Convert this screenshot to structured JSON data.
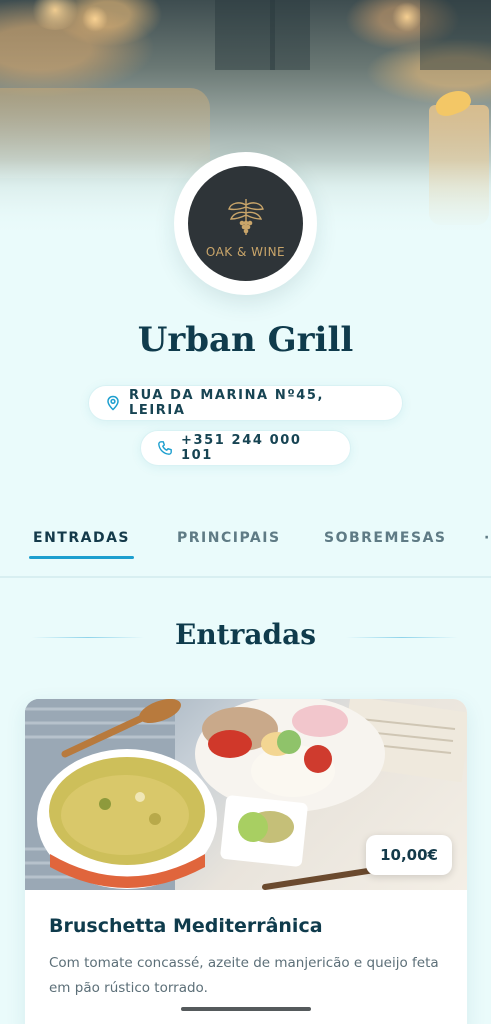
{
  "restaurant": {
    "logo_text": "OAK & WINE",
    "name": "Urban Grill",
    "address": "RUA DA MARINA Nº45, LEIRIA",
    "phone": "+351 244 000 101"
  },
  "icons": {
    "address": "location-pin-icon",
    "phone": "phone-icon",
    "logo": "oak-leaves-grapes-icon"
  },
  "tabs": [
    {
      "label": "ENTRADAS",
      "active": true
    },
    {
      "label": "PRINCIPAIS",
      "active": false
    },
    {
      "label": "SOBREMESAS",
      "active": false
    }
  ],
  "section": {
    "title": "Entradas"
  },
  "items": [
    {
      "name": "Bruschetta Mediterrânica",
      "description": "Com tomate concassé, azeite de manjericão e queijo feta em pão rústico torrado.",
      "price": "10,00€"
    }
  ],
  "colors": {
    "background": "#eafbfb",
    "primary_text": "#0f3b4c",
    "accent": "#1d9fcf",
    "logo_gold": "#c9a56a",
    "logo_bg": "#2e3438"
  }
}
